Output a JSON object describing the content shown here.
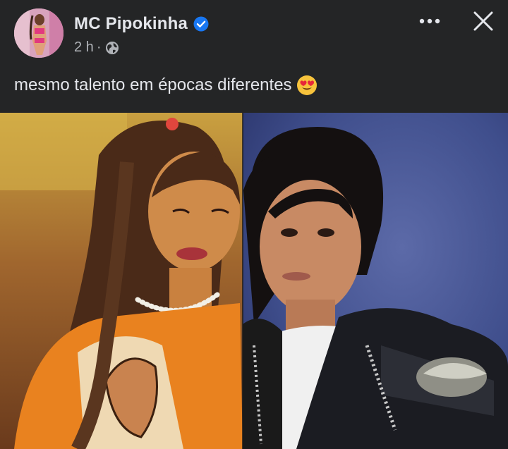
{
  "post": {
    "author": "MC Pipokinha",
    "timestamp": "2 h",
    "separator": "·",
    "caption": "mesmo talento em épocas diferentes",
    "caption_emoji": "heart-eyes-emoji",
    "verified_icon": "verified-badge-icon",
    "audience_icon": "globe-icon"
  },
  "colors": {
    "background": "#242526",
    "primary_text": "#e4e6eb",
    "secondary_text": "#b0b3b8",
    "verified_blue": "#1877f2"
  }
}
